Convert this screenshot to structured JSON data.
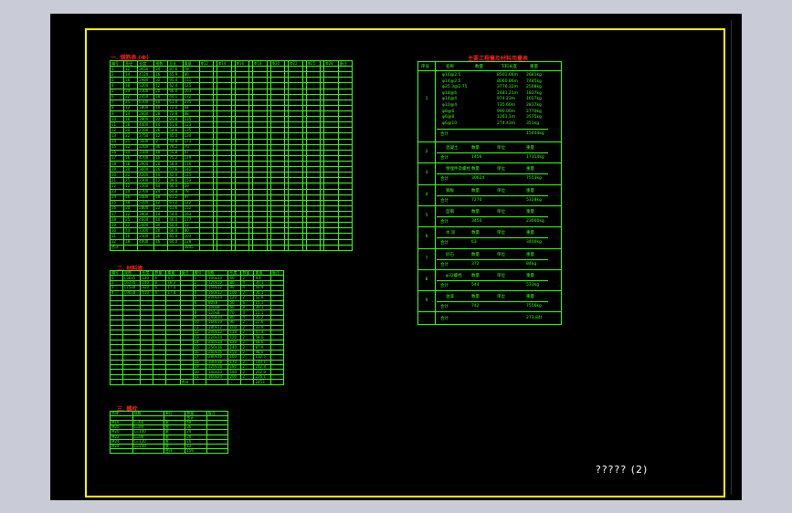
{
  "drawing_title": "????? (2)",
  "table1": {
    "title": "一. 钢筋表 (Ф)",
    "header": [
      "编号",
      "直径",
      "长度",
      "根数",
      "总长",
      "重量",
      "Φ12",
      "",
      "Φ14",
      "",
      "Φ16",
      "",
      "Φ18",
      "",
      "Φ20",
      "",
      "Φ22",
      "",
      "Φ25",
      "",
      "Φ28",
      "备注"
    ],
    "rows": [
      [
        "1",
        "12",
        "3650",
        "24",
        "87.6",
        "78",
        "",
        "",
        "",
        "",
        "",
        "",
        "",
        "",
        "",
        "",
        "",
        "",
        "",
        "",
        "",
        ""
      ],
      [
        "2",
        "14",
        "4120",
        "16",
        "65.9",
        "80",
        "",
        "",
        "",
        "",
        "",
        "",
        "",
        "",
        "",
        "",
        "",
        "",
        "",
        "",
        "",
        ""
      ],
      [
        "3",
        "16",
        "2980",
        "32",
        "95.4",
        "151",
        "",
        "",
        "",
        "",
        "",
        "",
        "",
        "",
        "",
        "",
        "",
        "",
        "",
        "",
        "",
        ""
      ],
      [
        "4",
        "18",
        "5200",
        "12",
        "62.4",
        "125",
        "",
        "",
        "",
        "",
        "",
        "",
        "",
        "",
        "",
        "",
        "",
        "",
        "",
        "",
        "",
        ""
      ],
      [
        "5",
        "20",
        "3300",
        "20",
        "66.0",
        "163",
        "",
        "",
        "",
        "",
        "",
        "",
        "",
        "",
        "",
        "",
        "",
        "",
        "",
        "",
        "",
        ""
      ],
      [
        "6",
        "22",
        "2450",
        "18",
        "44.1",
        "132",
        "",
        "",
        "",
        "",
        "",
        "",
        "",
        "",
        "",
        "",
        "",
        "",
        "",
        "",
        "",
        ""
      ],
      [
        "7",
        "25",
        "6100",
        "10",
        "61.0",
        "235",
        "",
        "",
        "",
        "",
        "",
        "",
        "",
        "",
        "",
        "",
        "",
        "",
        "",
        "",
        "",
        ""
      ],
      [
        "8",
        "12",
        "1800",
        "40",
        "72.0",
        "64",
        "",
        "",
        "",
        "",
        "",
        "",
        "",
        "",
        "",
        "",
        "",
        "",
        "",
        "",
        "",
        ""
      ],
      [
        "9",
        "14",
        "2600",
        "28",
        "72.8",
        "88",
        "",
        "",
        "",
        "",
        "",
        "",
        "",
        "",
        "",
        "",
        "",
        "",
        "",
        "",
        "",
        ""
      ],
      [
        "10",
        "16",
        "3900",
        "22",
        "85.8",
        "135",
        "",
        "",
        "",
        "",
        "",
        "",
        "",
        "",
        "",
        "",
        "",
        "",
        "",
        "",
        "",
        ""
      ],
      [
        "11",
        "18",
        "4400",
        "14",
        "61.6",
        "123",
        "",
        "",
        "",
        "",
        "",
        "",
        "",
        "",
        "",
        "",
        "",
        "",
        "",
        "",
        "",
        ""
      ],
      [
        "12",
        "20",
        "2100",
        "26",
        "54.6",
        "135",
        "",
        "",
        "",
        "",
        "",
        "",
        "",
        "",
        "",
        "",
        "",
        "",
        "",
        "",
        "",
        ""
      ],
      [
        "13",
        "22",
        "3750",
        "12",
        "45.0",
        "134",
        "",
        "",
        "",
        "",
        "",
        "",
        "",
        "",
        "",
        "",
        "",
        "",
        "",
        "",
        "",
        ""
      ],
      [
        "14",
        "25",
        "5600",
        "8",
        "44.8",
        "173",
        "",
        "",
        "",
        "",
        "",
        "",
        "",
        "",
        "",
        "",
        "",
        "",
        "",
        "",
        "",
        ""
      ],
      [
        "15",
        "12",
        "2200",
        "36",
        "79.2",
        "70",
        "",
        "",
        "",
        "",
        "",
        "",
        "",
        "",
        "",
        "",
        "",
        "",
        "",
        "",
        "",
        ""
      ],
      [
        "16",
        "14",
        "3100",
        "18",
        "55.8",
        "67",
        "",
        "",
        "",
        "",
        "",
        "",
        "",
        "",
        "",
        "",
        "",
        "",
        "",
        "",
        "",
        ""
      ],
      [
        "17",
        "16",
        "4700",
        "16",
        "75.2",
        "119",
        "",
        "",
        "",
        "",
        "",
        "",
        "",
        "",
        "",
        "",
        "",
        "",
        "",
        "",
        "",
        ""
      ],
      [
        "18",
        "18",
        "2900",
        "20",
        "58.0",
        "116",
        "",
        "",
        "",
        "",
        "",
        "",
        "",
        "",
        "",
        "",
        "",
        "",
        "",
        "",
        "",
        ""
      ],
      [
        "19",
        "20",
        "3600",
        "16",
        "57.6",
        "142",
        "",
        "",
        "",
        "",
        "",
        "",
        "",
        "",
        "",
        "",
        "",
        "",
        "",
        "",
        "",
        ""
      ],
      [
        "20",
        "22",
        "4200",
        "10",
        "42.0",
        "125",
        "",
        "",
        "",
        "",
        "",
        "",
        "",
        "",
        "",
        "",
        "",
        "",
        "",
        "",
        "",
        ""
      ],
      [
        "21",
        "25",
        "3300",
        "12",
        "39.6",
        "153",
        "",
        "",
        "",
        "",
        "",
        "",
        "",
        "",
        "",
        "",
        "",
        "",
        "",
        "",
        "",
        ""
      ],
      [
        "22",
        "12",
        "1500",
        "44",
        "66.0",
        "59",
        "",
        "",
        "",
        "",
        "",
        "",
        "",
        "",
        "",
        "",
        "",
        "",
        "",
        "",
        "",
        ""
      ],
      [
        "23",
        "14",
        "2700",
        "24",
        "64.8",
        "78",
        "",
        "",
        "",
        "",
        "",
        "",
        "",
        "",
        "",
        "",
        "",
        "",
        "",
        "",
        "",
        ""
      ],
      [
        "24",
        "16",
        "3400",
        "18",
        "61.2",
        "97",
        "",
        "",
        "",
        "",
        "",
        "",
        "",
        "",
        "",
        "",
        "",
        "",
        "",
        "",
        "",
        ""
      ],
      [
        "25",
        "18",
        "5100",
        "12",
        "61.2",
        "122",
        "",
        "",
        "",
        "",
        "",
        "",
        "",
        "",
        "",
        "",
        "",
        "",
        "",
        "",
        "",
        ""
      ],
      [
        "26",
        "20",
        "2800",
        "22",
        "61.6",
        "152",
        "",
        "",
        "",
        "",
        "",
        "",
        "",
        "",
        "",
        "",
        "",
        "",
        "",
        "",
        "",
        ""
      ],
      [
        "27",
        "22",
        "3900",
        "14",
        "54.6",
        "163",
        "",
        "",
        "",
        "",
        "",
        "",
        "",
        "",
        "",
        "",
        "",
        "",
        "",
        "",
        "",
        ""
      ],
      [
        "28",
        "25",
        "4600",
        "10",
        "46.0",
        "177",
        "",
        "",
        "",
        "",
        "",
        "",
        "",
        "",
        "",
        "",
        "",
        "",
        "",
        "",
        "",
        ""
      ],
      [
        "29",
        "12",
        "2000",
        "30",
        "60.0",
        "53",
        "",
        "",
        "",
        "",
        "",
        "",
        "",
        "",
        "",
        "",
        "",
        "",
        "",
        "",
        "",
        ""
      ],
      [
        "30",
        "14",
        "3300",
        "20",
        "66.0",
        "80",
        "",
        "",
        "",
        "",
        "",
        "",
        "",
        "",
        "",
        "",
        "",
        "",
        "",
        "",
        "",
        ""
      ],
      [
        "31",
        "16",
        "2500",
        "26",
        "65.0",
        "103",
        "",
        "",
        "",
        "",
        "",
        "",
        "",
        "",
        "",
        "",
        "",
        "",
        "",
        "",
        "",
        ""
      ],
      [
        "32",
        "18",
        "4000",
        "16",
        "64.0",
        "128",
        "",
        "",
        "",
        "",
        "",
        "",
        "",
        "",
        "",
        "",
        "",
        "",
        "",
        "",
        "",
        ""
      ],
      [
        "合计",
        "",
        "",
        "",
        "",
        "3845",
        "",
        "",
        "",
        "",
        "",
        "",
        "",
        "",
        "",
        "",
        "",
        "",
        "",
        "",
        "",
        ""
      ]
    ]
  },
  "table2": {
    "title": "二. 材料表",
    "header": [
      "编号",
      "规格",
      "长度",
      "数量",
      "重量",
      "备注",
      "编号",
      "规格",
      "长度",
      "数量",
      "重量",
      "备注"
    ],
    "rows": [
      [
        "1",
        "L50x5",
        "120",
        "4",
        "4.5",
        "",
        "1",
        "-100x10",
        "60",
        "2",
        "9.4",
        ""
      ],
      [
        "2",
        "L63x6",
        "240",
        "8",
        "18.3",
        "",
        "2",
        "-120x10",
        "80",
        "4",
        "30.1",
        ""
      ],
      [
        "3",
        "L75x8",
        "320",
        "6",
        "17.3",
        "",
        "3",
        "-150x12",
        "90",
        "4",
        "50.9",
        ""
      ],
      [
        "4",
        "L90x8",
        "410",
        "4",
        "17.8",
        "",
        "4",
        "-160x12",
        "100",
        "2",
        "30.1",
        ""
      ],
      [
        "",
        "",
        "",
        "",
        "",
        "",
        "5",
        "-200x14",
        "120",
        "2",
        "52.8",
        ""
      ],
      [
        "",
        "",
        "",
        "",
        "",
        "",
        "6",
        "-80x8",
        "50",
        "6",
        "15.1",
        ""
      ],
      [
        "",
        "",
        "",
        "",
        "",
        "",
        "7",
        "-100x8",
        "60",
        "8",
        "30.1",
        ""
      ],
      [
        "",
        "",
        "",
        "",
        "",
        "",
        "8",
        "-120x8",
        "70",
        "4",
        "21.1",
        ""
      ],
      [
        "",
        "",
        "",
        "",
        "",
        "",
        "9",
        "-140x10",
        "80",
        "4",
        "35.2",
        ""
      ],
      [
        "",
        "",
        "",
        "",
        "",
        "",
        "10",
        "-160x10",
        "90",
        "2",
        "22.6",
        ""
      ],
      [
        "",
        "",
        "",
        "",
        "",
        "",
        "11",
        "-180x12",
        "100",
        "2",
        "33.9",
        ""
      ],
      [
        "",
        "",
        "",
        "",
        "",
        "",
        "12",
        "-200x12",
        "110",
        "2",
        "41.4",
        ""
      ],
      [
        "",
        "",
        "",
        "",
        "",
        "",
        "13",
        "-220x14",
        "120",
        "2",
        "58.0",
        ""
      ],
      [
        "",
        "",
        "",
        "",
        "",
        "",
        "14",
        "-240x14",
        "130",
        "2",
        "68.6",
        ""
      ],
      [
        "",
        "",
        "",
        "",
        "",
        "",
        "15",
        "-250x16",
        "140",
        "2",
        "87.9",
        ""
      ],
      [
        "",
        "",
        "",
        "",
        "",
        "",
        "16",
        "-260x16",
        "150",
        "2",
        "98.0",
        ""
      ],
      [
        "",
        "",
        "",
        "",
        "",
        "",
        "17",
        "-280x16",
        "160",
        "2",
        "112.5",
        ""
      ],
      [
        "",
        "",
        "",
        "",
        "",
        "",
        "18",
        "-300x18",
        "170",
        "2",
        "144.1",
        ""
      ],
      [
        "",
        "",
        "",
        "",
        "",
        "",
        "19",
        "-320x18",
        "180",
        "2",
        "162.8",
        ""
      ],
      [
        "",
        "",
        "",
        "",
        "",
        "",
        "20",
        "-340x20",
        "190",
        "2",
        "202.9",
        ""
      ],
      [
        "",
        "",
        "",
        "",
        "",
        "",
        "21",
        "-360x20",
        "200",
        "2",
        "226.1",
        ""
      ],
      [
        "",
        "",
        "",
        "",
        "",
        "合计",
        "",
        "",
        "",
        "",
        "2453",
        ""
      ]
    ]
  },
  "table3": {
    "title": "三. 螺栓",
    "header": [
      "名称",
      "规格",
      "单位",
      "数量",
      "备注"
    ],
    "rows": [
      [
        "",
        "",
        "",
        "合计",
        ""
      ],
      [
        "M16",
        "L=60",
        "套",
        "48",
        ""
      ],
      [
        "M20",
        "L=80",
        "套",
        "36",
        ""
      ],
      [
        "M20",
        "L=100",
        "套",
        "24",
        ""
      ],
      [
        "M22",
        "L=90",
        "套",
        "20",
        ""
      ],
      [
        "M24",
        "L=120",
        "套",
        "16",
        ""
      ],
      [
        "M24",
        "L=150",
        "套",
        "12",
        ""
      ],
      [
        "",
        "",
        "合计",
        "156",
        ""
      ]
    ]
  },
  "table_right": {
    "title": "主要工程量及材料用量表",
    "header": [
      "序号",
      "名称",
      "数量",
      "下料长度",
      "重量"
    ],
    "section1": {
      "num": "1",
      "rows": [
        [
          "φ16@2.5",
          "",
          "8501.66m",
          "2681kg"
        ],
        [
          "φ14@2.5",
          "",
          "8060.86m",
          "7485kg"
        ],
        [
          "φ25.3@2.75",
          "",
          "3776.32m",
          "2508kg"
        ],
        [
          "φ18@6",
          "",
          "2481.21m",
          "1827kg"
        ],
        [
          "φ14@4",
          "",
          "974.23m",
          "1657kg"
        ],
        [
          "φ10@4",
          "",
          "735.60m",
          "2817kg"
        ],
        [
          "φ8@6",
          "",
          "990.00m",
          "2770kg"
        ],
        [
          "φ6@8",
          "",
          "1261.1m",
          "3575kg"
        ],
        [
          "φ6@10",
          "",
          "274.43m",
          "351kg"
        ]
      ],
      "total_label": "合计",
      "total": "15404kg"
    },
    "sections": [
      {
        "num": "2",
        "h": [
          "混凝土",
          "数量",
          "单位",
          "重量"
        ],
        "t": [
          "合计",
          "1456",
          "",
          "17314kg"
        ]
      },
      {
        "num": "3",
        "h": [
          "预埋件及螺栓",
          "数量",
          "单位",
          "重量"
        ],
        "t": [
          "合计",
          "30624",
          "",
          "7553kg"
        ]
      },
      {
        "num": "4",
        "h": [
          "钢板",
          "数量",
          "单位",
          "重量"
        ],
        "t": [
          "合计",
          "7270",
          "",
          "5328kg"
        ]
      },
      {
        "num": "5",
        "h": [
          "型钢",
          "数量",
          "单位",
          "重量"
        ],
        "t": [
          "合计",
          "3450",
          "",
          "23000kg"
        ]
      },
      {
        "num": "6",
        "h": [
          "水 泥",
          "数量",
          "单位",
          "重量"
        ],
        "t": [
          "合计",
          "63",
          "",
          "3400kg"
        ]
      },
      {
        "num": "7",
        "h": [
          "砂石",
          "数量",
          "单位",
          "重量"
        ],
        "t": [
          "合计",
          "372",
          "",
          "84kg"
        ]
      },
      {
        "num": "8",
        "h": [
          "φ32螺栓",
          "数量",
          "单位",
          "重量"
        ],
        "t": [
          "合计",
          "544",
          "",
          "533kg"
        ]
      },
      {
        "num": "9",
        "h": [
          "油漆",
          "数量",
          "单位",
          "重量"
        ],
        "t": [
          "合计",
          "742",
          "",
          "7556kg"
        ]
      }
    ],
    "grand_total_label": "合计",
    "grand_total": "273.84t"
  }
}
